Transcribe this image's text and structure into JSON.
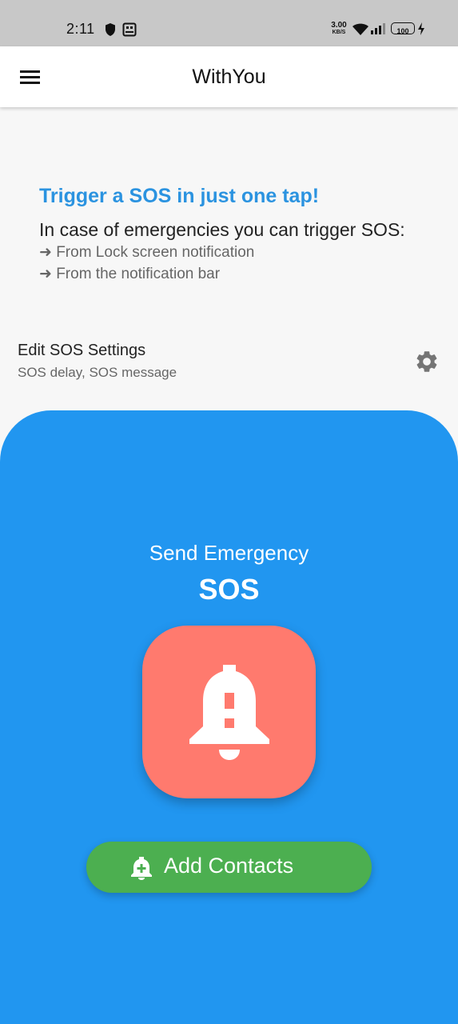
{
  "status_bar": {
    "time": "2:11",
    "network_speed_value": "3.00",
    "network_speed_unit": "KB/S",
    "battery": "100",
    "icons": [
      "shield-icon",
      "photo-icon",
      "wifi-icon",
      "signal-icon",
      "battery-icon",
      "charging-icon"
    ]
  },
  "app_bar": {
    "title": "WithYou",
    "menu_icon": "hamburger-menu-icon"
  },
  "promo": {
    "heading": "Trigger a SOS in just one tap!",
    "subheading": "In case of emergencies you can trigger SOS:",
    "lines": [
      "➜ From Lock screen notification",
      "➜ From the notification bar"
    ]
  },
  "settings": {
    "title": "Edit SOS Settings",
    "subtitle": "SOS delay, SOS message",
    "icon": "gear-icon"
  },
  "emergency": {
    "label": "Send Emergency",
    "sos": "SOS",
    "button_icon": "alert-bell-icon",
    "add_contacts_label": "Add Contacts",
    "add_contacts_icon": "add-alert-icon"
  },
  "colors": {
    "accent_blue": "#2196f0",
    "heading_blue": "#2b93e0",
    "sos_button": "#ff7a6e",
    "add_contacts_green": "#4caf50",
    "status_bar_gray": "#c8c8c8"
  }
}
